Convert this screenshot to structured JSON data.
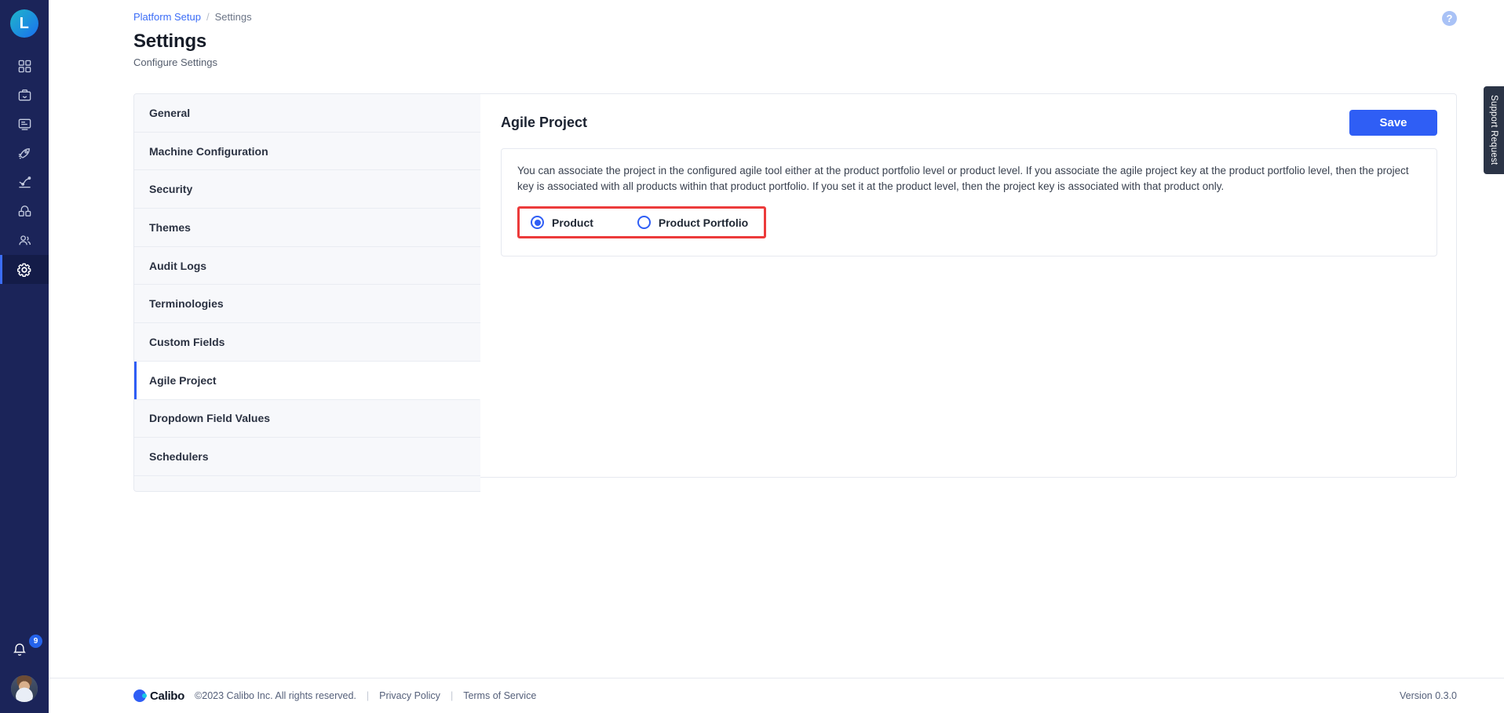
{
  "rail": {
    "logo_letter": "L",
    "items": [
      {
        "name": "dashboard-icon",
        "label": "Dashboard",
        "active": false
      },
      {
        "name": "briefcase-icon",
        "label": "Portfolio",
        "active": false
      },
      {
        "name": "board-icon",
        "label": "Boards",
        "active": false
      },
      {
        "name": "rocket-icon",
        "label": "Launch",
        "active": false
      },
      {
        "name": "analytics-icon",
        "label": "Analytics",
        "active": false
      },
      {
        "name": "integrations-icon",
        "label": "Integrations",
        "active": false
      },
      {
        "name": "users-icon",
        "label": "Users",
        "active": false
      },
      {
        "name": "gear-icon",
        "label": "Settings",
        "active": true
      }
    ],
    "notifications_count": "9"
  },
  "header": {
    "breadcrumb_parent": "Platform Setup",
    "breadcrumb_separator": "/",
    "breadcrumb_current": "Settings",
    "title": "Settings",
    "subtitle": "Configure Settings",
    "help_glyph": "?"
  },
  "settings_menu": {
    "items": [
      {
        "label": "General",
        "active": false
      },
      {
        "label": "Machine Configuration",
        "active": false
      },
      {
        "label": "Security",
        "active": false
      },
      {
        "label": "Themes",
        "active": false
      },
      {
        "label": "Audit Logs",
        "active": false
      },
      {
        "label": "Terminologies",
        "active": false
      },
      {
        "label": "Custom Fields",
        "active": false
      },
      {
        "label": "Agile Project",
        "active": true
      },
      {
        "label": "Dropdown Field Values",
        "active": false
      },
      {
        "label": "Schedulers",
        "active": false
      }
    ]
  },
  "detail": {
    "title": "Agile Project",
    "save_label": "Save",
    "description": "You can associate the project in the configured agile tool either at the product portfolio level or product level. If you associate the agile project key at the product portfolio level, then the project key is associated with all products within that product portfolio. If you set it at the product level, then the project key is associated with that product only.",
    "radio_group": {
      "options": [
        {
          "label": "Product",
          "checked": true
        },
        {
          "label": "Product Portfolio",
          "checked": false
        }
      ],
      "highlight_color": "#EC3B3B"
    }
  },
  "footer": {
    "brand_name": "Calibo",
    "copyright": "©2023 Calibo Inc. All rights reserved.",
    "separator": "|",
    "privacy_label": "Privacy Policy",
    "terms_label": "Terms of Service",
    "version": "Version 0.3.0"
  },
  "support_tab": {
    "label": "Support Request"
  },
  "colors": {
    "accent": "#2F5EF5",
    "rail_bg": "#1B2459",
    "panel_bg": "#F7F8FB",
    "border": "#E6E9F0",
    "highlight_red": "#EC3B3B"
  }
}
